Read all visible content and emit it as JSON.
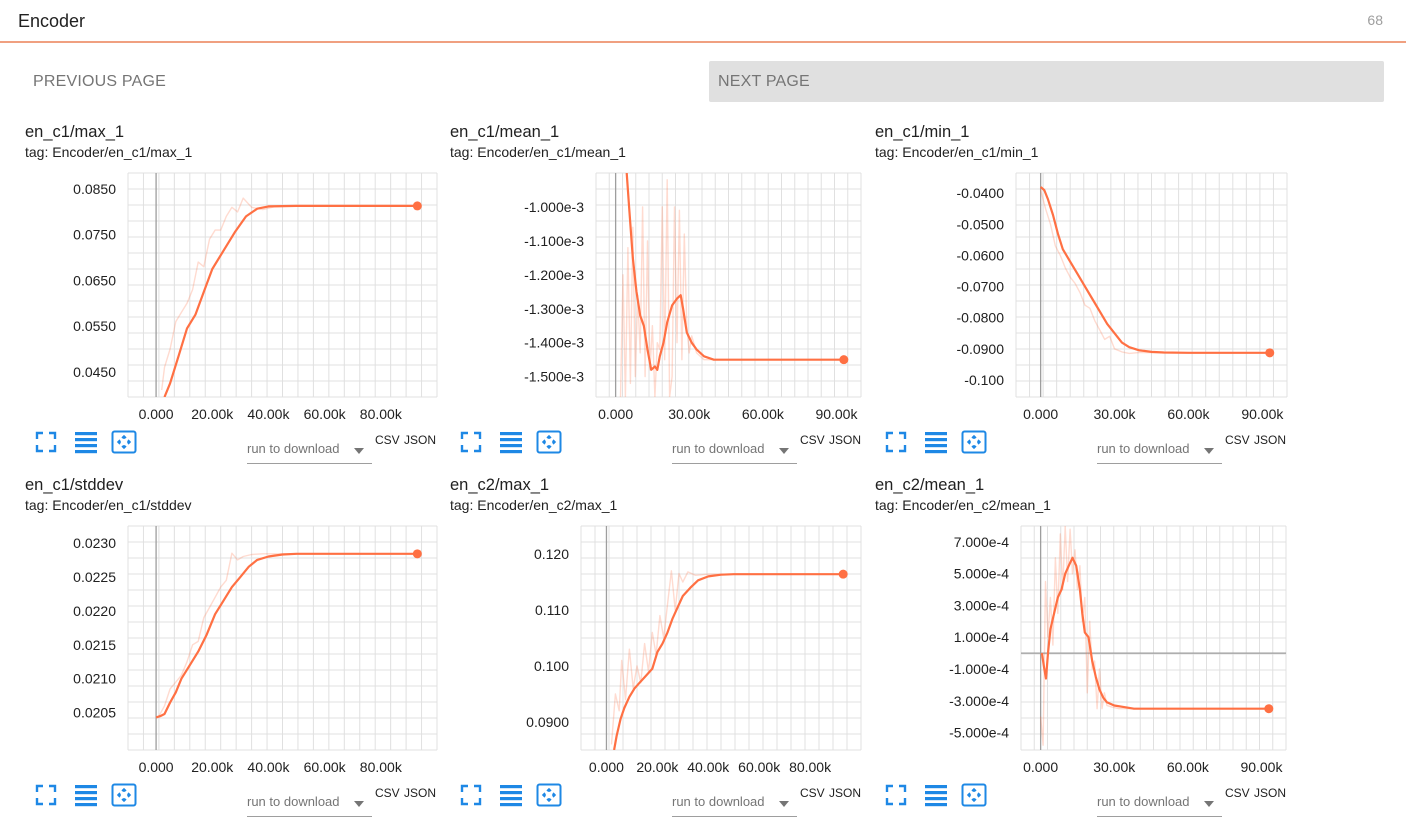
{
  "header": {
    "title": "Encoder",
    "count": "68"
  },
  "pager": {
    "previous_label": "PREVIOUS PAGE",
    "next_label": "NEXT PAGE"
  },
  "card_ui": {
    "download_placeholder": "run to download",
    "csv_label": "CSV",
    "json_label": "JSON"
  },
  "accent_color": "#ff7043",
  "chart_data": [
    {
      "type": "line",
      "title": "en_c1/max_1",
      "tag": "tag: Encoder/en_c1/max_1",
      "xlim": [
        -10000,
        100000
      ],
      "ylim": [
        0.0395,
        0.0885
      ],
      "x_ticks": [
        {
          "v": 0,
          "l": "0.000"
        },
        {
          "v": 20000,
          "l": "20.00k"
        },
        {
          "v": 40000,
          "l": "40.00k"
        },
        {
          "v": 60000,
          "l": "60.00k"
        },
        {
          "v": 80000,
          "l": "80.00k"
        }
      ],
      "y_ticks": [
        {
          "v": 0.085,
          "l": "0.0850"
        },
        {
          "v": 0.075,
          "l": "0.0750"
        },
        {
          "v": 0.065,
          "l": "0.0650"
        },
        {
          "v": 0.055,
          "l": "0.0550"
        },
        {
          "v": 0.045,
          "l": "0.0450"
        }
      ],
      "series": [
        {
          "style": "smoothed",
          "x": [
            3000,
            5000,
            8000,
            11000,
            14000,
            17000,
            20000,
            24000,
            28000,
            32000,
            36000,
            40000,
            50000,
            60000,
            80000,
            93000
          ],
          "y": [
            0.0395,
            0.0425,
            0.0485,
            0.0545,
            0.0575,
            0.0625,
            0.0675,
            0.0715,
            0.0755,
            0.079,
            0.0807,
            0.0812,
            0.0813,
            0.0813,
            0.0813,
            0.0813
          ]
        },
        {
          "style": "raw",
          "x": [
            2000,
            3000,
            5000,
            7000,
            9000,
            11000,
            13000,
            15000,
            17000,
            19000,
            21000,
            23000,
            25000,
            27000,
            29000,
            31000,
            34000,
            38000,
            42000,
            50000,
            60000,
            80000,
            93000
          ],
          "y": [
            0.041,
            0.046,
            0.05,
            0.056,
            0.058,
            0.06,
            0.063,
            0.069,
            0.068,
            0.074,
            0.076,
            0.076,
            0.079,
            0.081,
            0.08,
            0.083,
            0.081,
            0.0805,
            0.0811,
            0.0813,
            0.0813,
            0.0813,
            0.0813
          ]
        }
      ],
      "last_point": {
        "x": 93000,
        "y": 0.0813
      }
    },
    {
      "type": "line",
      "title": "en_c1/mean_1",
      "tag": "tag: Encoder/en_c1/mean_1",
      "xlim": [
        -8000,
        100000
      ],
      "ylim": [
        -0.00156,
        -0.0009
      ],
      "x_ticks": [
        {
          "v": 0,
          "l": "0.000"
        },
        {
          "v": 30000,
          "l": "30.00k"
        },
        {
          "v": 60000,
          "l": "60.00k"
        },
        {
          "v": 90000,
          "l": "90.00k"
        }
      ],
      "y_ticks": [
        {
          "v": -0.001,
          "l": "-1.000e-3"
        },
        {
          "v": -0.0011,
          "l": "-1.100e-3"
        },
        {
          "v": -0.0012,
          "l": "-1.200e-3"
        },
        {
          "v": -0.0013,
          "l": "-1.300e-3"
        },
        {
          "v": -0.0014,
          "l": "-1.400e-3"
        },
        {
          "v": -0.0015,
          "l": "-1.500e-3"
        }
      ],
      "series": [
        {
          "style": "smoothed",
          "x": [
            4500,
            5500,
            7000,
            8500,
            10000,
            11500,
            13000,
            14500,
            16000,
            17000,
            18000,
            19500,
            21000,
            23000,
            25000,
            26500,
            27500,
            29000,
            31000,
            33000,
            36000,
            40000,
            45000,
            55000,
            70000,
            93000
          ],
          "y": [
            -0.0009,
            -0.001,
            -0.00115,
            -0.00125,
            -0.00132,
            -0.00135,
            -0.00142,
            -0.00148,
            -0.00147,
            -0.00148,
            -0.00144,
            -0.0014,
            -0.00134,
            -0.00129,
            -0.00127,
            -0.00126,
            -0.0013,
            -0.00137,
            -0.0014,
            -0.00142,
            -0.00144,
            -0.00145,
            -0.00145,
            -0.00145,
            -0.00145,
            -0.00145
          ]
        },
        {
          "style": "raw",
          "x": [
            2000,
            3000,
            4000,
            5000,
            6000,
            7000,
            8000,
            9000,
            10000,
            11000,
            12000,
            13000,
            14000,
            15000,
            16000,
            17000,
            18000,
            19000,
            20000,
            21000,
            22000,
            23000,
            24000,
            25000,
            26000,
            27000,
            28000,
            29000,
            30000,
            31000,
            33000,
            36000,
            40000,
            50000,
            70000,
            93000
          ],
          "y": [
            -0.00156,
            -0.0012,
            -0.00156,
            -0.00112,
            -0.00152,
            -0.00106,
            -0.0015,
            -0.00126,
            -0.00143,
            -0.001,
            -0.0015,
            -0.0011,
            -0.00148,
            -0.00135,
            -0.00156,
            -0.0014,
            -0.00142,
            -0.001,
            -0.00145,
            -0.00092,
            -0.00156,
            -0.0015,
            -0.001,
            -0.0014,
            -0.00101,
            -0.00145,
            -0.00108,
            -0.00135,
            -0.00143,
            -0.00138,
            -0.00143,
            -0.00145,
            -0.00145,
            -0.00145,
            -0.00145,
            -0.00145
          ]
        }
      ],
      "last_point": {
        "x": 93000,
        "y": -0.00145
      }
    },
    {
      "type": "line",
      "title": "en_c1/min_1",
      "tag": "tag: Encoder/en_c1/min_1",
      "xlim": [
        -10000,
        100000
      ],
      "ylim": [
        -0.1055,
        -0.0335
      ],
      "x_ticks": [
        {
          "v": 0,
          "l": "0.000"
        },
        {
          "v": 30000,
          "l": "30.00k"
        },
        {
          "v": 60000,
          "l": "60.00k"
        },
        {
          "v": 90000,
          "l": "90.00k"
        }
      ],
      "y_ticks": [
        {
          "v": -0.04,
          "l": "-0.0400"
        },
        {
          "v": -0.05,
          "l": "-0.0500"
        },
        {
          "v": -0.06,
          "l": "-0.0600"
        },
        {
          "v": -0.07,
          "l": "-0.0700"
        },
        {
          "v": -0.08,
          "l": "-0.0800"
        },
        {
          "v": -0.09,
          "l": "-0.0900"
        },
        {
          "v": -0.1,
          "l": "-0.100"
        }
      ],
      "series": [
        {
          "style": "smoothed",
          "x": [
            0,
            1500,
            3000,
            5000,
            7000,
            9000,
            12000,
            15000,
            18000,
            21000,
            24000,
            27000,
            30000,
            33000,
            36000,
            40000,
            45000,
            50000,
            60000,
            80000,
            93000
          ],
          "y": [
            -0.038,
            -0.039,
            -0.042,
            -0.047,
            -0.053,
            -0.058,
            -0.062,
            -0.066,
            -0.07,
            -0.074,
            -0.078,
            -0.082,
            -0.085,
            -0.088,
            -0.0895,
            -0.0905,
            -0.091,
            -0.0912,
            -0.0913,
            -0.0913,
            -0.0913
          ]
        },
        {
          "style": "raw",
          "x": [
            0,
            2000,
            4000,
            6000,
            8000,
            10000,
            12000,
            14000,
            16000,
            18000,
            20000,
            22000,
            24000,
            26000,
            28000,
            30000,
            33000,
            36000,
            40000,
            50000,
            93000
          ],
          "y": [
            -0.039,
            -0.045,
            -0.05,
            -0.057,
            -0.06,
            -0.064,
            -0.067,
            -0.069,
            -0.072,
            -0.076,
            -0.077,
            -0.081,
            -0.084,
            -0.087,
            -0.086,
            -0.09,
            -0.091,
            -0.0915,
            -0.0912,
            -0.0913,
            -0.0913
          ]
        }
      ],
      "last_point": {
        "x": 93000,
        "y": -0.0913
      }
    },
    {
      "type": "line",
      "title": "en_c1/stddev",
      "tag": "tag: Encoder/en_c1/stddev",
      "xlim": [
        -10000,
        100000
      ],
      "ylim": [
        0.01995,
        0.02325
      ],
      "x_ticks": [
        {
          "v": 0,
          "l": "0.000"
        },
        {
          "v": 20000,
          "l": "20.00k"
        },
        {
          "v": 40000,
          "l": "40.00k"
        },
        {
          "v": 60000,
          "l": "60.00k"
        },
        {
          "v": 80000,
          "l": "80.00k"
        }
      ],
      "y_ticks": [
        {
          "v": 0.023,
          "l": "0.0230"
        },
        {
          "v": 0.0225,
          "l": "0.0225"
        },
        {
          "v": 0.022,
          "l": "0.0220"
        },
        {
          "v": 0.0215,
          "l": "0.0215"
        },
        {
          "v": 0.021,
          "l": "0.0210"
        },
        {
          "v": 0.0205,
          "l": "0.0205"
        }
      ],
      "series": [
        {
          "style": "smoothed",
          "x": [
            0,
            1500,
            3000,
            5000,
            7000,
            9000,
            12000,
            15000,
            18000,
            21000,
            24000,
            27000,
            30000,
            33000,
            36000,
            40000,
            45000,
            50000,
            60000,
            80000,
            93000
          ],
          "y": [
            0.02043,
            0.02045,
            0.02048,
            0.02065,
            0.0208,
            0.021,
            0.0212,
            0.0214,
            0.02165,
            0.02195,
            0.02215,
            0.02235,
            0.0225,
            0.02265,
            0.02275,
            0.0228,
            0.02283,
            0.02284,
            0.02284,
            0.02284,
            0.02284
          ]
        },
        {
          "style": "raw",
          "x": [
            1000,
            3000,
            5000,
            7000,
            9000,
            11000,
            13000,
            15000,
            17000,
            19000,
            21000,
            23000,
            25000,
            27000,
            29000,
            31000,
            34000,
            38000,
            42000,
            50000,
            93000
          ],
          "y": [
            0.02045,
            0.0206,
            0.02085,
            0.02095,
            0.02105,
            0.02125,
            0.0215,
            0.02155,
            0.0219,
            0.02205,
            0.0222,
            0.02235,
            0.02245,
            0.02285,
            0.02275,
            0.0228,
            0.02283,
            0.02284,
            0.02284,
            0.02284,
            0.02284
          ]
        }
      ],
      "last_point": {
        "x": 93000,
        "y": 0.02284
      }
    },
    {
      "type": "line",
      "title": "en_c2/max_1",
      "tag": "tag: Encoder/en_c2/max_1",
      "xlim": [
        -10000,
        100000
      ],
      "ylim": [
        0.085,
        0.125
      ],
      "x_ticks": [
        {
          "v": 0,
          "l": "0.000"
        },
        {
          "v": 20000,
          "l": "20.00k"
        },
        {
          "v": 40000,
          "l": "40.00k"
        },
        {
          "v": 60000,
          "l": "60.00k"
        },
        {
          "v": 80000,
          "l": "80.00k"
        }
      ],
      "y_ticks": [
        {
          "v": 0.12,
          "l": "0.120"
        },
        {
          "v": 0.11,
          "l": "0.110"
        },
        {
          "v": 0.1,
          "l": "0.100"
        },
        {
          "v": 0.09,
          "l": "0.0900"
        }
      ],
      "series": [
        {
          "style": "smoothed",
          "x": [
            3000,
            4000,
            5500,
            7000,
            9000,
            11000,
            13000,
            15000,
            18000,
            20000,
            22000,
            24000,
            26000,
            28000,
            30000,
            33000,
            36000,
            40000,
            45000,
            50000,
            60000,
            80000,
            93000
          ],
          "y": [
            0.085,
            0.0875,
            0.0905,
            0.0925,
            0.0945,
            0.096,
            0.097,
            0.098,
            0.0995,
            0.1025,
            0.104,
            0.106,
            0.1085,
            0.1105,
            0.1125,
            0.114,
            0.1153,
            0.116,
            0.1163,
            0.1164,
            0.1164,
            0.1164,
            0.1164
          ]
        },
        {
          "style": "raw",
          "x": [
            2000,
            3500,
            5000,
            6000,
            7500,
            9000,
            10500,
            12000,
            13500,
            15000,
            16500,
            18000,
            19500,
            21000,
            22500,
            24000,
            25500,
            27000,
            28500,
            30000,
            32000,
            35000,
            40000,
            50000,
            93000
          ],
          "y": [
            0.086,
            0.095,
            0.092,
            0.101,
            0.094,
            0.103,
            0.096,
            0.1,
            0.097,
            0.104,
            0.099,
            0.106,
            0.102,
            0.109,
            0.105,
            0.111,
            0.117,
            0.11,
            0.1165,
            0.115,
            0.1168,
            0.1162,
            0.1164,
            0.1164,
            0.1164
          ]
        }
      ],
      "last_point": {
        "x": 93000,
        "y": 0.1164
      }
    },
    {
      "type": "line",
      "title": "en_c2/mean_1",
      "tag": "tag: Encoder/en_c2/mean_1",
      "xlim": [
        -8000,
        100000
      ],
      "ylim": [
        -0.00061,
        0.0008
      ],
      "x_ticks": [
        {
          "v": 0,
          "l": "0.000"
        },
        {
          "v": 30000,
          "l": "30.00k"
        },
        {
          "v": 60000,
          "l": "60.00k"
        },
        {
          "v": 90000,
          "l": "90.00k"
        }
      ],
      "y_ticks": [
        {
          "v": 0.0007,
          "l": "7.000e-4"
        },
        {
          "v": 0.0005,
          "l": "5.000e-4"
        },
        {
          "v": 0.0003,
          "l": "3.000e-4"
        },
        {
          "v": 0.0001,
          "l": "1.000e-4"
        },
        {
          "v": -0.0001,
          "l": "-1.000e-4"
        },
        {
          "v": -0.0003,
          "l": "-3.000e-4"
        },
        {
          "v": -0.0005,
          "l": "-5.000e-4"
        }
      ],
      "series": [
        {
          "style": "smoothed",
          "x": [
            500,
            1500,
            2200,
            3000,
            4000,
            5500,
            7000,
            8500,
            10000,
            11500,
            13000,
            14500,
            16000,
            17000,
            18000,
            19500,
            21000,
            22500,
            24000,
            25500,
            27000,
            30000,
            34000,
            38000,
            45000,
            60000,
            80000,
            93000
          ],
          "y": [
            0.0,
            -0.0001,
            -0.00016,
            0.0,
            0.00015,
            0.00025,
            0.00035,
            0.0004,
            0.0005,
            0.00055,
            0.0006,
            0.00055,
            0.0004,
            0.00025,
            0.00013,
            0.0001,
            -5e-05,
            -0.00015,
            -0.00023,
            -0.00028,
            -0.00031,
            -0.00033,
            -0.00034,
            -0.00035,
            -0.00035,
            -0.00035,
            -0.00035,
            -0.00035
          ]
        },
        {
          "style": "raw",
          "x": [
            0,
            1000,
            2000,
            3000,
            4000,
            5000,
            6000,
            7000,
            8000,
            9000,
            10000,
            11000,
            12000,
            13000,
            14000,
            15000,
            16000,
            17000,
            18000,
            19000,
            20000,
            21000,
            22000,
            23000,
            24000,
            25000,
            26000,
            27000,
            29000,
            32000,
            36000,
            45000,
            93000
          ],
          "y": [
            -0.0004,
            -0.00058,
            0.00045,
            0.0001,
            0.00035,
            5e-05,
            0.0006,
            0.00025,
            0.00075,
            0.0004,
            0.0008,
            0.00045,
            0.00078,
            0.0005,
            0.00065,
            0.0004,
            0.00055,
            0.0002,
            0.00035,
            -0.00025,
            0.0002,
            -0.0001,
            -5e-05,
            -0.00035,
            -0.0001,
            -0.00035,
            -0.00025,
            -0.00033,
            -0.00034,
            -0.00035,
            -0.00035,
            -0.00035,
            -0.00035
          ]
        }
      ],
      "last_point": {
        "x": 93000,
        "y": -0.00035
      }
    }
  ]
}
